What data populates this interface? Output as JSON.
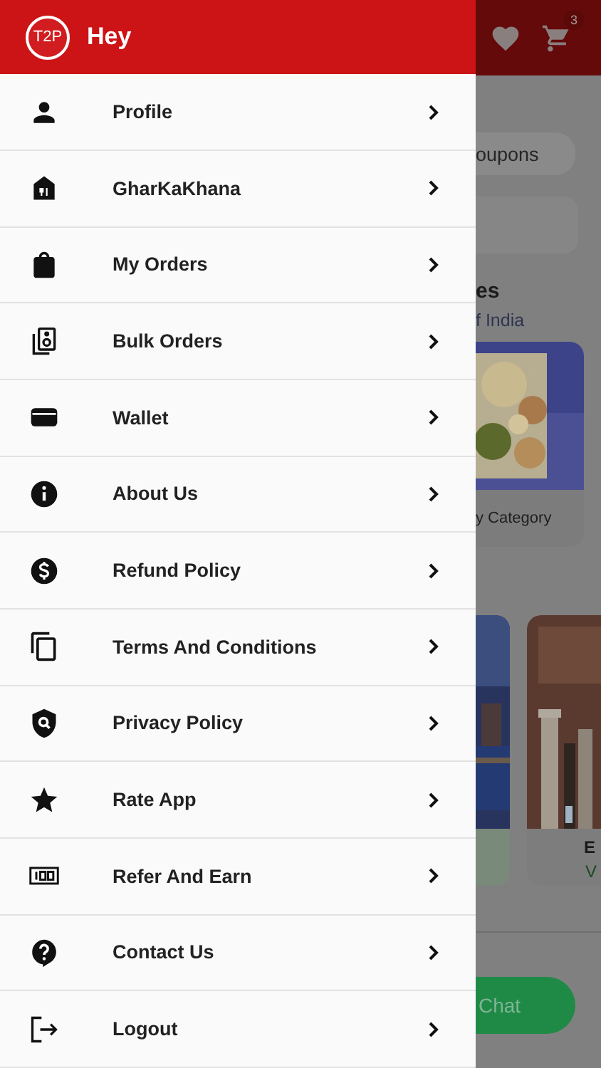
{
  "header": {
    "logo": "T2P",
    "title": "Hey"
  },
  "menu": [
    {
      "label": "Profile"
    },
    {
      "label": "GharKaKhana"
    },
    {
      "label": "My Orders"
    },
    {
      "label": "Bulk Orders"
    },
    {
      "label": "Wallet"
    },
    {
      "label": "About Us"
    },
    {
      "label": "Refund Policy"
    },
    {
      "label": "Terms And Conditions"
    },
    {
      "label": "Privacy Policy"
    },
    {
      "label": "Rate App"
    },
    {
      "label": "Refer And Earn"
    },
    {
      "label": "Contact Us"
    },
    {
      "label": "Logout"
    }
  ],
  "background": {
    "cart_badge": "3",
    "coupons": "oupons",
    "section_title": "es",
    "section_subtitle": "f India",
    "category_card": {
      "label": "y Category"
    },
    "place_card": {
      "title": "E",
      "subtitle": "V"
    },
    "chat_button": "Chat"
  }
}
